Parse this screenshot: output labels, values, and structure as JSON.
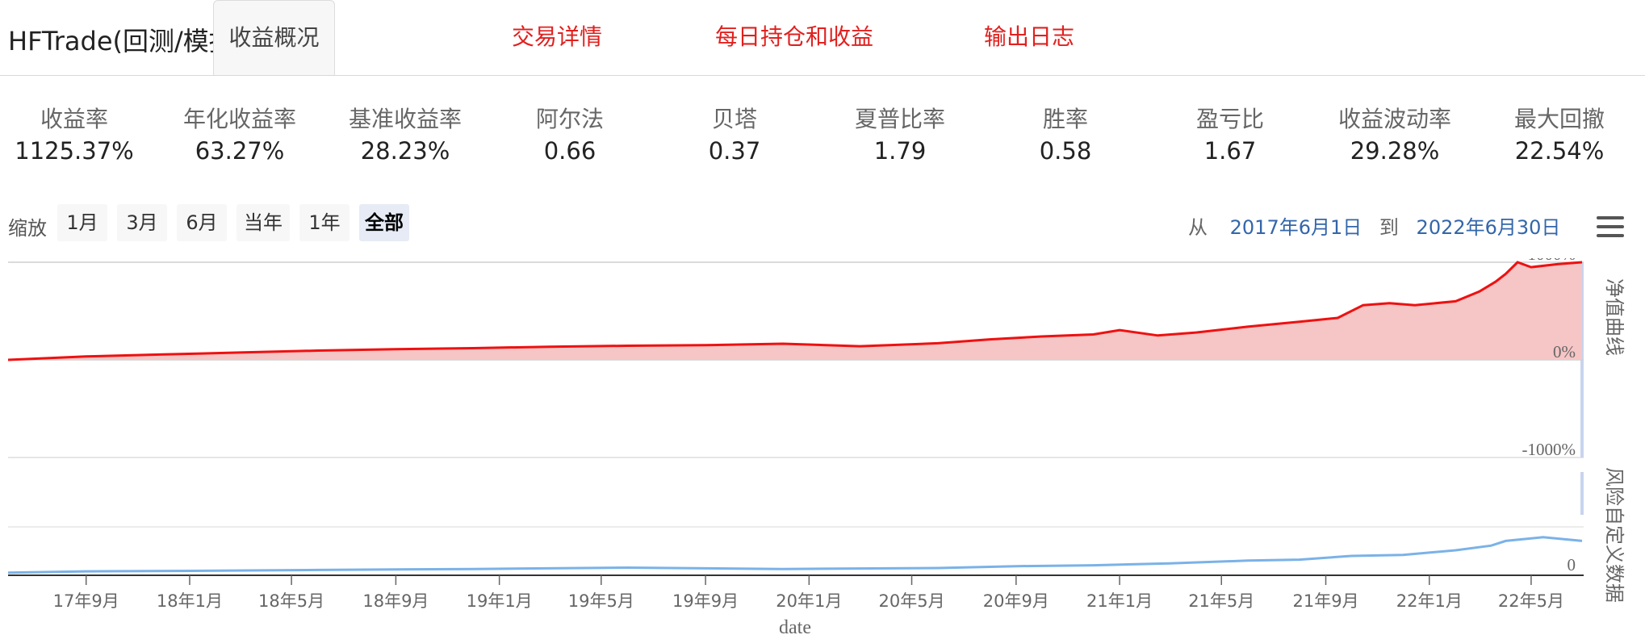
{
  "app": {
    "title": "HFTrade(回测/模拟)"
  },
  "tabs": [
    {
      "label": "收益概况",
      "active": true
    },
    {
      "label": "交易详情"
    },
    {
      "label": "每日持仓和收益"
    },
    {
      "label": "输出日志"
    }
  ],
  "metrics": [
    {
      "label": "收益率",
      "value": "1125.37%"
    },
    {
      "label": "年化收益率",
      "value": "63.27%"
    },
    {
      "label": "基准收益率",
      "value": "28.23%"
    },
    {
      "label": "阿尔法",
      "value": "0.66"
    },
    {
      "label": "贝塔",
      "value": "0.37"
    },
    {
      "label": "夏普比率",
      "value": "1.79"
    },
    {
      "label": "胜率",
      "value": "0.58"
    },
    {
      "label": "盈亏比",
      "value": "1.67"
    },
    {
      "label": "收益波动率",
      "value": "29.28%"
    },
    {
      "label": "最大回撤",
      "value": "22.54%"
    }
  ],
  "zoom": {
    "label": "缩放",
    "buttons": [
      "1月",
      "3月",
      "6月",
      "当年",
      "1年",
      "全部"
    ],
    "selected": "全部"
  },
  "range": {
    "from_label": "从",
    "from": "2017年6月1日",
    "to_label": "到",
    "to": "2022年6月30日"
  },
  "colors": {
    "accent_red": "#e0211f",
    "net_value_line": "#ee1111",
    "net_value_fill": "#f6c5c5",
    "risk_line": "#7ab2e8",
    "date_blue": "#3366aa"
  },
  "icons": {
    "menu": "hamburger-menu-icon"
  },
  "chart_data": {
    "type": "line",
    "xlabel": "date",
    "x_range": [
      "2017-06-01",
      "2022-06-30"
    ],
    "x_ticks": [
      "17年9月",
      "18年1月",
      "18年5月",
      "18年9月",
      "19年1月",
      "19年5月",
      "19年9月",
      "20年1月",
      "20年5月",
      "20年9月",
      "21年1月",
      "21年5月",
      "21年9月",
      "22年1月",
      "22年5月"
    ],
    "x_tick_dates": [
      "2017-09-01",
      "2018-01-01",
      "2018-05-01",
      "2018-09-01",
      "2019-01-01",
      "2019-05-01",
      "2019-09-01",
      "2020-01-01",
      "2020-05-01",
      "2020-09-01",
      "2021-01-01",
      "2021-05-01",
      "2021-09-01",
      "2022-01-01",
      "2022-05-01"
    ],
    "panels": [
      {
        "name": "净值曲线",
        "y_ticks": [
          "1000%",
          "0%",
          "-1000%"
        ],
        "y_tick_values": [
          1000,
          0,
          -1000
        ],
        "ylim": [
          -1000,
          1000
        ],
        "series": [
          {
            "name": "净值曲线",
            "type": "area",
            "x": [
              "2017-06-01",
              "2017-09-01",
              "2017-12-01",
              "2018-03-01",
              "2018-06-01",
              "2018-09-01",
              "2018-12-01",
              "2019-03-01",
              "2019-06-01",
              "2019-09-01",
              "2019-12-01",
              "2020-03-01",
              "2020-06-01",
              "2020-08-01",
              "2020-10-01",
              "2020-12-01",
              "2021-01-01",
              "2021-02-15",
              "2021-04-01",
              "2021-06-01",
              "2021-08-01",
              "2021-09-15",
              "2021-10-15",
              "2021-11-15",
              "2021-12-15",
              "2022-02-01",
              "2022-03-01",
              "2022-03-20",
              "2022-04-01",
              "2022-04-15",
              "2022-05-01",
              "2022-06-01",
              "2022-06-30"
            ],
            "y": [
              0,
              35,
              55,
              75,
              95,
              110,
              120,
              135,
              145,
              150,
              165,
              140,
              170,
              210,
              240,
              260,
              305,
              250,
              280,
              340,
              390,
              430,
              560,
              580,
              560,
              600,
              700,
              800,
              880,
              1000,
              950,
              980,
              1000
            ]
          }
        ]
      },
      {
        "name": "风险自定义数据",
        "y_ticks": [
          "0"
        ],
        "y_tick_values": [
          0
        ],
        "ylim": [
          0,
          1
        ],
        "series": [
          {
            "name": "风险自定义数据",
            "type": "line",
            "x": [
              "2017-06-01",
              "2017-09-01",
              "2018-01-01",
              "2018-06-01",
              "2018-12-01",
              "2019-06-01",
              "2019-12-01",
              "2020-06-01",
              "2020-09-01",
              "2020-12-01",
              "2021-03-01",
              "2021-06-01",
              "2021-08-01",
              "2021-10-01",
              "2021-12-01",
              "2022-02-01",
              "2022-03-15",
              "2022-04-01",
              "2022-05-15",
              "2022-06-30"
            ],
            "y": [
              0.02,
              0.05,
              0.06,
              0.08,
              0.1,
              0.13,
              0.1,
              0.12,
              0.16,
              0.18,
              0.22,
              0.28,
              0.3,
              0.38,
              0.4,
              0.5,
              0.6,
              0.7,
              0.78,
              0.7
            ]
          }
        ]
      }
    ]
  }
}
